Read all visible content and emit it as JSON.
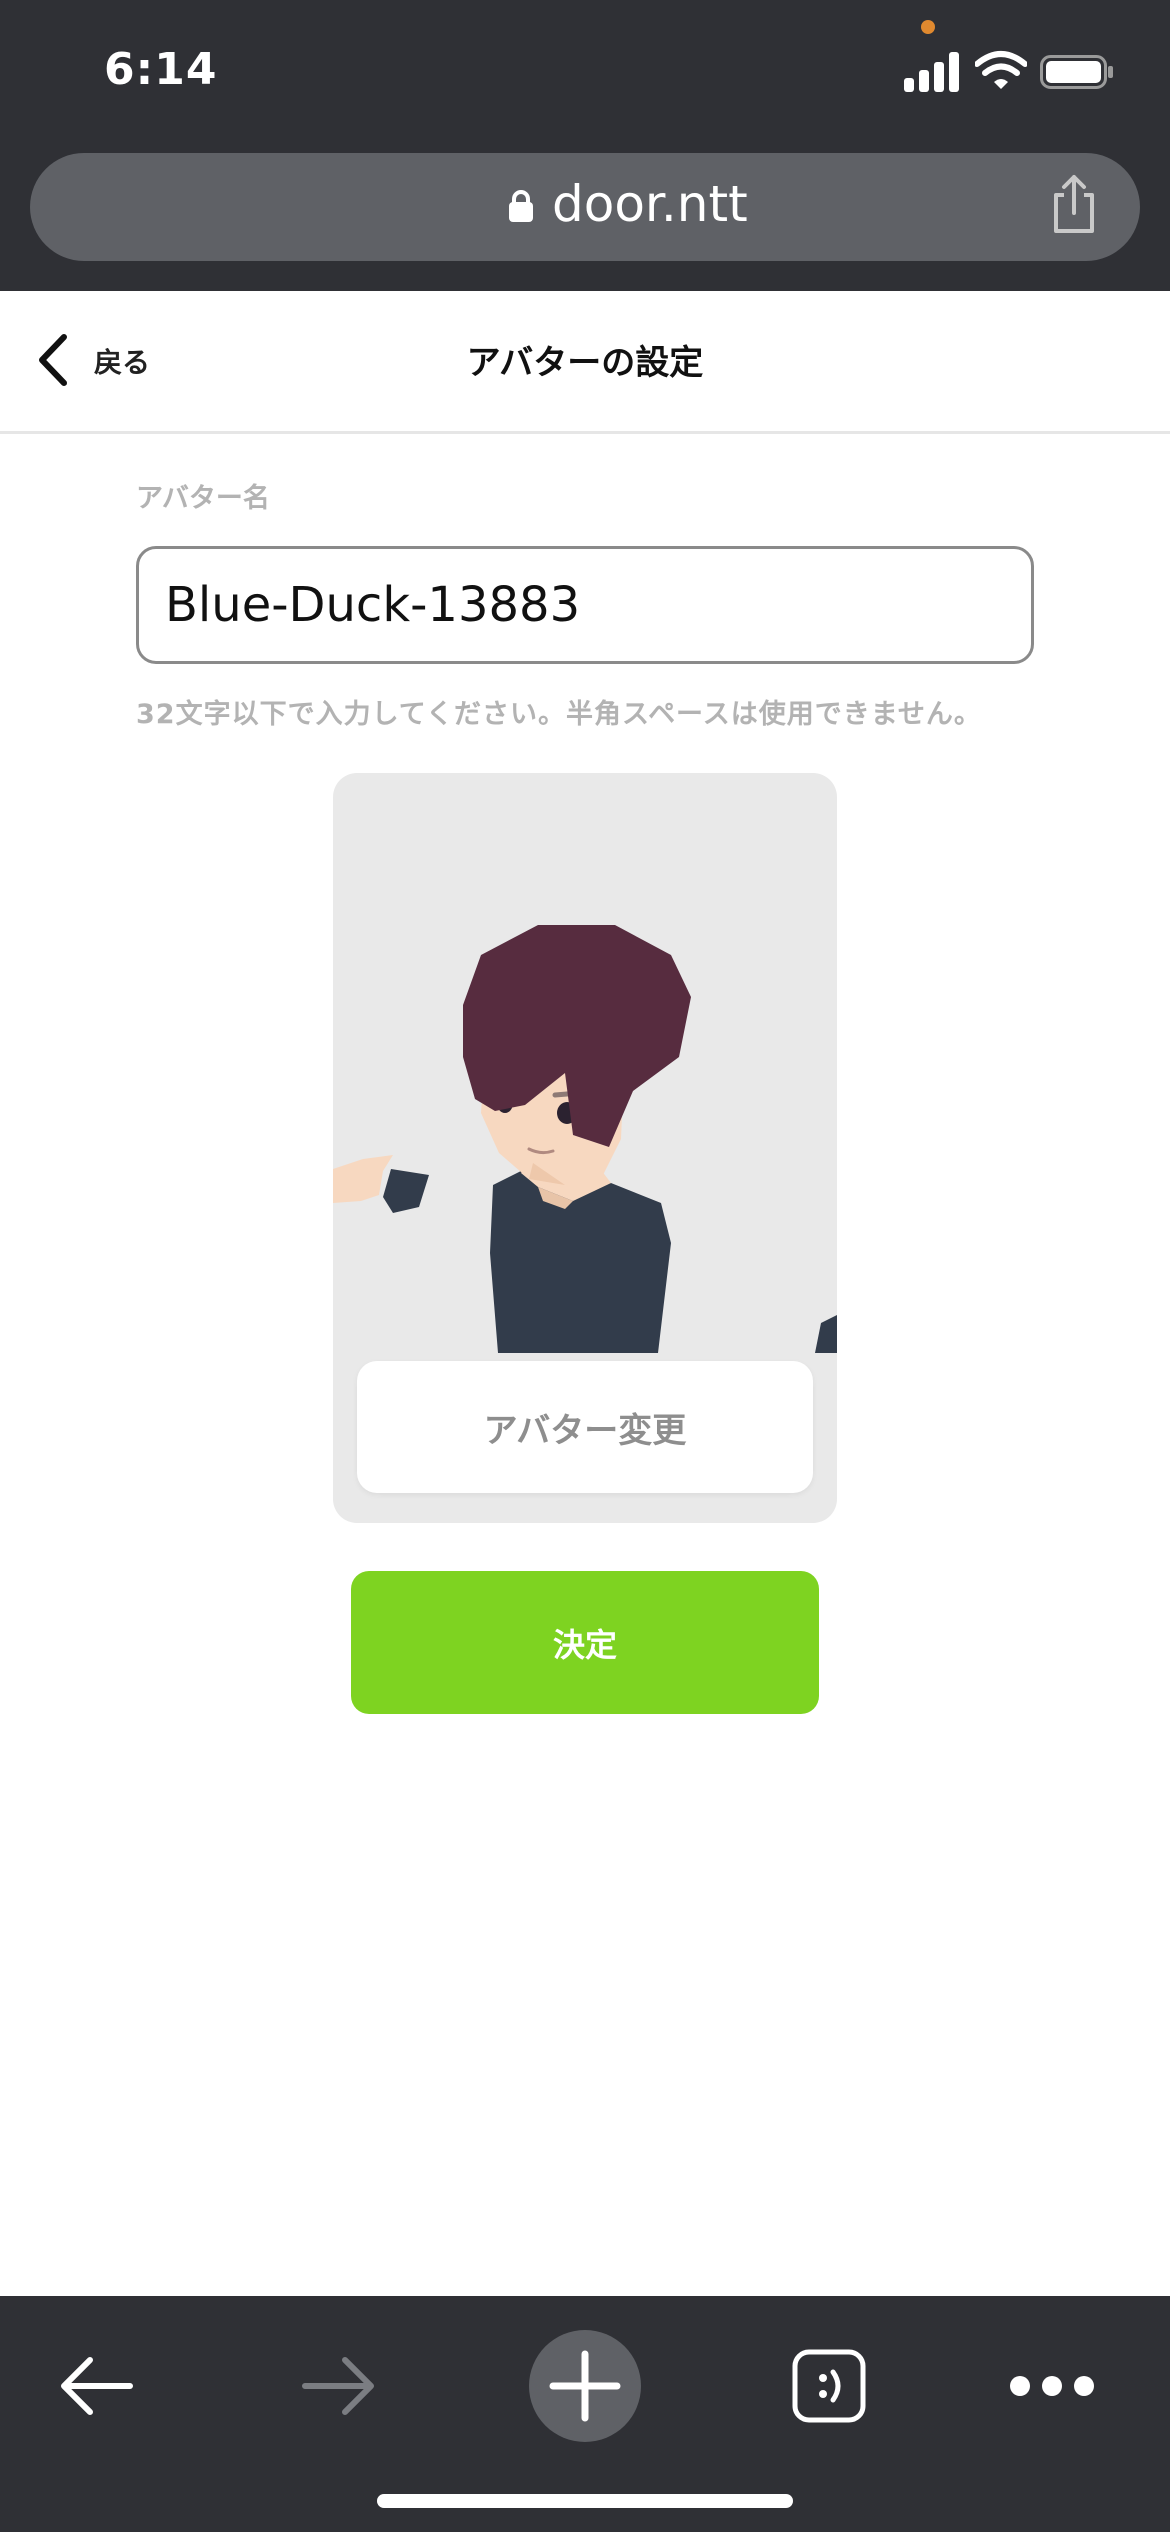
{
  "status_bar": {
    "time": "6:14"
  },
  "url_bar": {
    "domain": "door.ntt"
  },
  "nav": {
    "back_label": "戻る",
    "title": "アバターの設定"
  },
  "form": {
    "name_label": "アバター名",
    "name_value": "Blue-Duck-13883",
    "hint": "32文字以下で入力してください。半角スペースは使用できません。"
  },
  "avatar": {
    "change_label": "アバター変更"
  },
  "confirm_label": "決定",
  "colors": {
    "chrome_bg": "#2f3035",
    "url_bar_bg": "#5f6166",
    "confirm_green": "#7ed321",
    "card_bg": "#e9e9e9",
    "hair": "#572c3f",
    "shirt": "#323c4b",
    "skin": "#f7d8c0"
  },
  "icons": [
    "lock-icon",
    "share-icon",
    "back-chevron-icon",
    "arrow-left-icon",
    "arrow-right-icon",
    "plus-icon",
    "tabs-icon",
    "more-icon"
  ]
}
